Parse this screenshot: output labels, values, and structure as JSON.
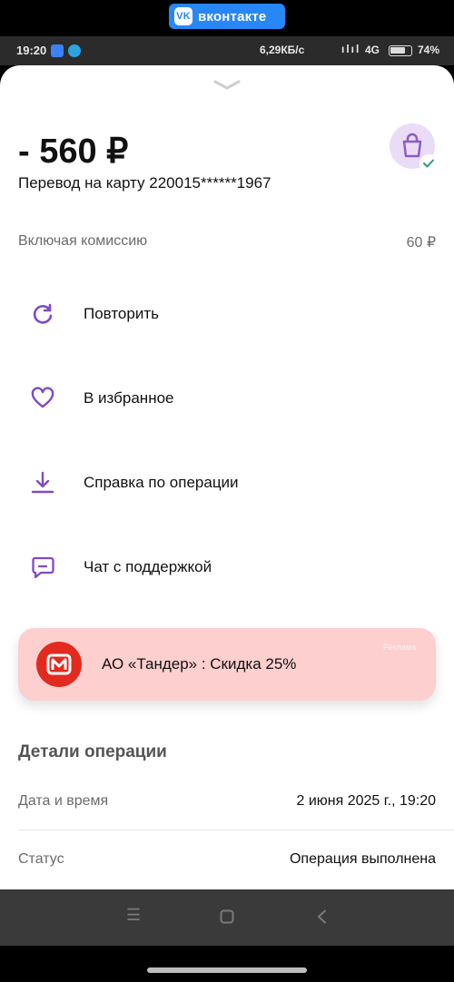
{
  "banner": {
    "text": "вконтакте",
    "logo_text": "VK"
  },
  "statusbar": {
    "time": "19:20",
    "speed": "6,29КБ/с",
    "network": "4G",
    "battery_percent": "74%",
    "battery_level": 0.74
  },
  "transaction": {
    "amount": "- 560 ₽",
    "description": "Перевод на карту 220015******1967",
    "fee_label": "Включая комиссию",
    "fee_value": "60 ₽"
  },
  "actions": [
    {
      "label": "Повторить",
      "icon": "repeat-icon"
    },
    {
      "label": "В избранное",
      "icon": "heart-icon"
    },
    {
      "label": "Справка по операции",
      "icon": "download-icon"
    },
    {
      "label": "Чат с поддержкой",
      "icon": "chat-icon"
    }
  ],
  "ad": {
    "text": "АО «Тандер» : Скидка 25%",
    "tag": "Реклама"
  },
  "details": {
    "title": "Детали операции",
    "rows": [
      {
        "label": "Дата и время",
        "value": "2 июня 2025 г., 19:20"
      },
      {
        "label": "Статус",
        "value": "Операция выполнена"
      }
    ]
  },
  "colors": {
    "accent": "#7e4bc2",
    "ad_bg": "#fdcfcf",
    "banner": "#2787f5"
  }
}
